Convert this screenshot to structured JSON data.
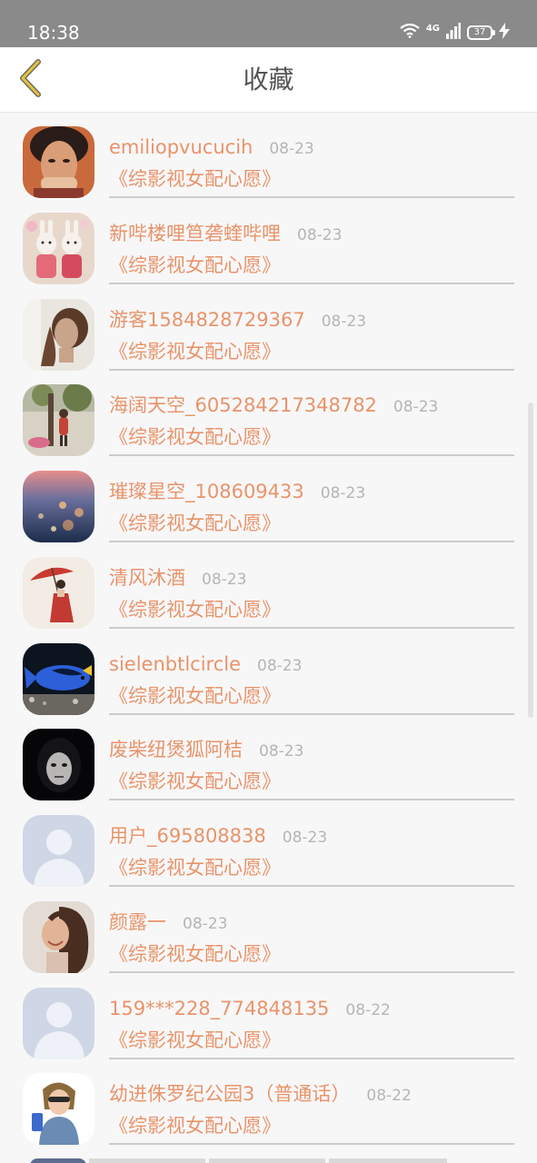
{
  "status_bar": {
    "time": "18:38",
    "network": "4G",
    "battery": "37"
  },
  "header": {
    "title": "收藏"
  },
  "items": [
    {
      "name": "emiliopvucucih",
      "date": "08-23",
      "title": "《综影视女配心愿》",
      "avatar": "avatar-woman-face"
    },
    {
      "name": "新哔楼哩笪砻蝰哔哩",
      "date": "08-23",
      "title": "《综影视女配心愿》",
      "avatar": "avatar-bunny-figures"
    },
    {
      "name": "游客1584828729367",
      "date": "08-23",
      "title": "《综影视女配心愿》",
      "avatar": "avatar-mannequin-head"
    },
    {
      "name": "海阔天空_605284217348782",
      "date": "08-23",
      "title": "《综影视女配心愿》",
      "avatar": "avatar-child-tree"
    },
    {
      "name": "璀璨星空_108609433",
      "date": "08-23",
      "title": "《综影视女配心愿》",
      "avatar": "avatar-bokeh-lights"
    },
    {
      "name": "清风沐酒",
      "date": "08-23",
      "title": "《综影视女配心愿》",
      "avatar": "avatar-umbrella-girl"
    },
    {
      "name": "sielenbtlcircle",
      "date": "08-23",
      "title": "《综影视女配心愿》",
      "avatar": "avatar-blue-fish"
    },
    {
      "name": "废柴纽煲狐阿桔",
      "date": "08-23",
      "title": "《综影视女配心愿》",
      "avatar": "avatar-dark-mask"
    },
    {
      "name": "用户_695808838",
      "date": "08-23",
      "title": "《综影视女配心愿》",
      "avatar": "avatar-default-person"
    },
    {
      "name": "颜露一",
      "date": "08-23",
      "title": "《综影视女配心愿》",
      "avatar": "avatar-smiling-woman"
    },
    {
      "name": "159***228_774848135",
      "date": "08-22",
      "title": "《综影视女配心愿》",
      "avatar": "avatar-default-person"
    },
    {
      "name": "幼进侏罗纪公园3（普通话）",
      "date": "08-22",
      "title": "《综影视女配心愿》",
      "avatar": "avatar-girl-sunglasses"
    }
  ],
  "colors": {
    "accent": "#e8946a",
    "date": "#b5b5b5",
    "status_bar": "#8a8a8a",
    "back_icon": "#e6c23a"
  }
}
